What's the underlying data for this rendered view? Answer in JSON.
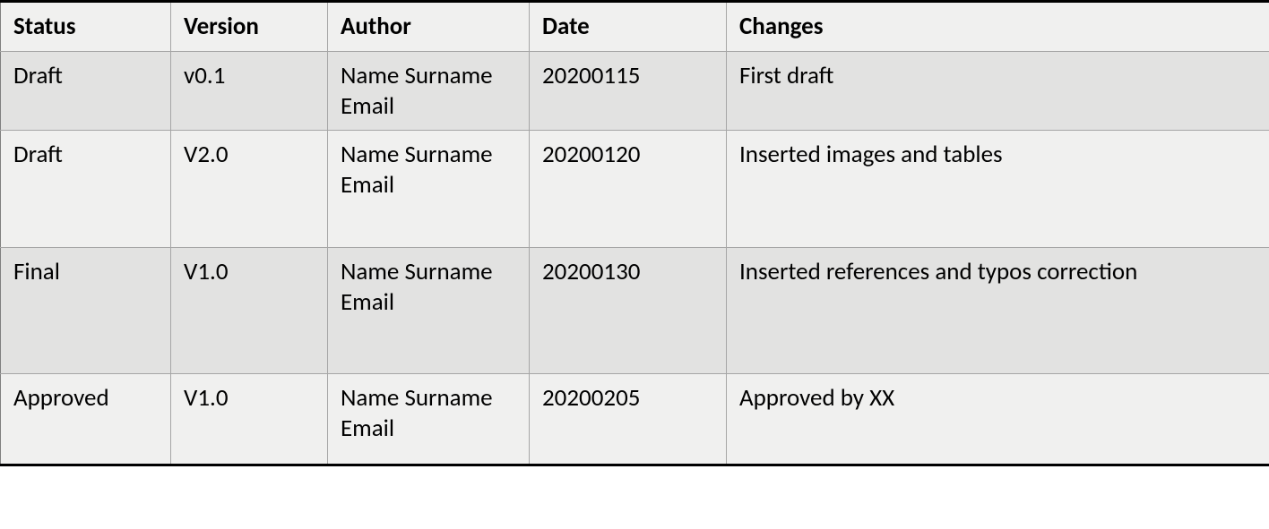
{
  "table": {
    "headers": {
      "status": "Status",
      "version": "Version",
      "author": "Author",
      "date": "Date",
      "changes": "Changes"
    },
    "rows": [
      {
        "status": "Draft",
        "version": "v0.1",
        "author": "Name Surname Email",
        "date": "20200115",
        "changes": "First draft"
      },
      {
        "status": "Draft",
        "version": "V2.0",
        "author": "Name Surname Email",
        "date": "20200120",
        "changes": "Inserted images and tables"
      },
      {
        "status": "Final",
        "version": "V1.0",
        "author": "Name Surname Email",
        "date": "20200130",
        "changes": "Inserted references and typos correction"
      },
      {
        "status": "Approved",
        "version": "V1.0",
        "author": "Name Surname Email",
        "date": "20200205",
        "changes": "Approved by XX"
      }
    ]
  }
}
